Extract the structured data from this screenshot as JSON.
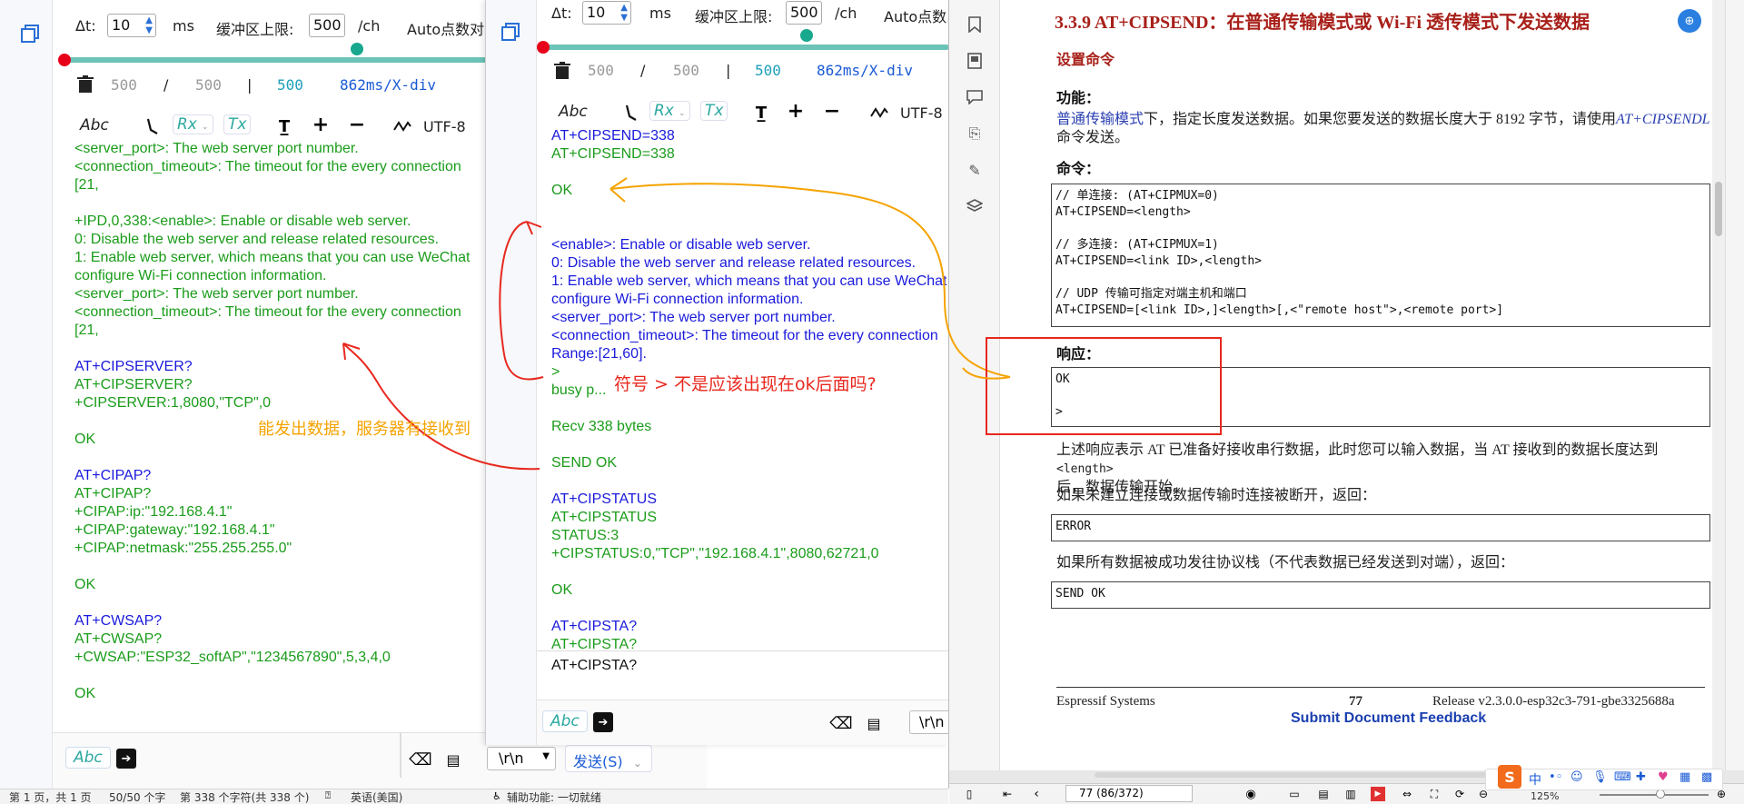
{
  "left_panel": {
    "delta_label": "Δt:",
    "delta_value": "10",
    "ms": "ms",
    "buffer_label": "缓冲区上限:",
    "buffer_value": "500",
    "per_ch": "/ch",
    "auto_label": "Auto点数对:",
    "count_a": "500",
    "slash": "/",
    "count_b": "500",
    "pipe": "|",
    "count_c": "500",
    "xdiv": "862ms/X-div",
    "fmt_abc": "Abc",
    "fmt_rx": "Rx",
    "fmt_tx": "Tx",
    "encoding": "UTF-8",
    "log_lines": [
      {
        "t": "<server_port>: The web server port number.",
        "c": "g"
      },
      {
        "t": "<connection_timeout>: The timeout for the every connection",
        "c": "g"
      },
      {
        "t": "[21,",
        "c": "g"
      },
      {
        "t": "",
        "c": "g"
      },
      {
        "t": "+IPD,0,338:<enable>: Enable or disable web server.",
        "c": "g"
      },
      {
        "t": "0: Disable the web server and release related resources.",
        "c": "g"
      },
      {
        "t": "1: Enable web server, which means that you can use WeChat",
        "c": "g"
      },
      {
        "t": "configure Wi-Fi connection information.",
        "c": "g"
      },
      {
        "t": "<server_port>: The web server port number.",
        "c": "g"
      },
      {
        "t": "<connection_timeout>: The timeout for the every connection",
        "c": "g"
      },
      {
        "t": "[21,",
        "c": "g"
      },
      {
        "t": "",
        "c": "g"
      },
      {
        "t": "AT+CIPSERVER?",
        "c": "b"
      },
      {
        "t": "AT+CIPSERVER?",
        "c": "g"
      },
      {
        "t": "+CIPSERVER:1,8080,\"TCP\",0",
        "c": "g"
      },
      {
        "t": "",
        "c": "g"
      },
      {
        "t": "OK",
        "c": "g"
      },
      {
        "t": "",
        "c": "g"
      },
      {
        "t": "AT+CIPAP?",
        "c": "b"
      },
      {
        "t": "AT+CIPAP?",
        "c": "g"
      },
      {
        "t": "+CIPAP:ip:\"192.168.4.1\"",
        "c": "g"
      },
      {
        "t": "+CIPAP:gateway:\"192.168.4.1\"",
        "c": "g"
      },
      {
        "t": "+CIPAP:netmask:\"255.255.255.0\"",
        "c": "g"
      },
      {
        "t": "",
        "c": "g"
      },
      {
        "t": "OK",
        "c": "g"
      },
      {
        "t": "",
        "c": "g"
      },
      {
        "t": "AT+CWSAP?",
        "c": "b"
      },
      {
        "t": "AT+CWSAP?",
        "c": "g"
      },
      {
        "t": "+CWSAP:\"ESP32_softAP\",\"1234567890\",5,3,4,0",
        "c": "g"
      },
      {
        "t": "",
        "c": "g"
      },
      {
        "t": "OK",
        "c": "g"
      }
    ],
    "bottom_abc": "Abc",
    "line_end": "\\r\\n",
    "send_button": "发送(S)"
  },
  "middle_panel": {
    "delta_label": "Δt:",
    "delta_value": "10",
    "ms": "ms",
    "buffer_label": "缓冲区上限:",
    "buffer_value": "500",
    "per_ch": "/ch",
    "auto_label": "Auto点数",
    "count_a": "500",
    "slash": "/",
    "count_b": "500",
    "pipe": "|",
    "count_c": "500",
    "xdiv": "862ms/X-div",
    "fmt_abc": "Abc",
    "fmt_rx": "Rx",
    "fmt_tx": "Tx",
    "encoding": "UTF-8",
    "log_lines": [
      {
        "t": "AT+CIPSEND=338",
        "c": "b"
      },
      {
        "t": "AT+CIPSEND=338",
        "c": "g"
      },
      {
        "t": "",
        "c": "g"
      },
      {
        "t": "OK",
        "c": "g"
      },
      {
        "t": "",
        "c": "g"
      },
      {
        "t": "",
        "c": "g"
      },
      {
        "t": "<enable>: Enable or disable web server.",
        "c": "b"
      },
      {
        "t": "0: Disable the web server and release related resources.",
        "c": "b"
      },
      {
        "t": "1: Enable web server, which means that you can use WeChat",
        "c": "b"
      },
      {
        "t": "configure Wi-Fi connection information.",
        "c": "b"
      },
      {
        "t": "<server_port>: The web server port number.",
        "c": "b"
      },
      {
        "t": "<connection_timeout>: The timeout for the every connection",
        "c": "b"
      },
      {
        "t": "Range:[21,60].",
        "c": "b"
      },
      {
        "t": ">",
        "c": "g"
      },
      {
        "t": "busy p...",
        "c": "g"
      },
      {
        "t": "",
        "c": "g"
      },
      {
        "t": "Recv 338 bytes",
        "c": "g"
      },
      {
        "t": "",
        "c": "g"
      },
      {
        "t": "SEND OK",
        "c": "g"
      },
      {
        "t": "",
        "c": "g"
      },
      {
        "t": "AT+CIPSTATUS",
        "c": "b"
      },
      {
        "t": "AT+CIPSTATUS",
        "c": "g"
      },
      {
        "t": "STATUS:3",
        "c": "g"
      },
      {
        "t": "+CIPSTATUS:0,\"TCP\",\"192.168.4.1\",8080,62721,0",
        "c": "g"
      },
      {
        "t": "",
        "c": "g"
      },
      {
        "t": "OK",
        "c": "g"
      },
      {
        "t": "",
        "c": "g"
      },
      {
        "t": "AT+CIPSTA?",
        "c": "b"
      },
      {
        "t": "AT+CIPSTA?",
        "c": "g"
      }
    ],
    "input_text": "AT+CIPSTA?",
    "bottom_abc": "Abc",
    "line_end": "\\r\\n"
  },
  "annotations": {
    "left_note": "能发出数据，服务器有接收到",
    "mid_note": "符号 > 不是应该出现在ok后面吗?",
    "colors": {
      "orange": "#f5a300",
      "red": "#e8281e"
    }
  },
  "pdf": {
    "section_title": "3.3.9   AT+CIPSEND：在普通传输模式或 Wi-Fi 透传模式下发送数据",
    "set_cmd": "设置命令",
    "func_label": "功能：",
    "func_link": "普通传输模式",
    "func_text1": "下，指定长度发送数据。如果您要发送的数据长度大于 8192 字节，请使用",
    "func_link2": "AT+CIPSENDL",
    "func_text2": "命令发送。",
    "cmd_label": "命令：",
    "code_block": "// 单连接: (AT+CIPMUX=0)\nAT+CIPSEND=<length>\n\n// 多连接: (AT+CIPMUX=1)\nAT+CIPSEND=<link ID>,<length>\n\n// UDP 传输可指定对端主机和端口\nAT+CIPSEND=[<link ID>,]<length>[,<\"remote host\">,<remote port>]",
    "resp_label": "响应：",
    "resp_block": "OK\n\n>",
    "desc1a": "上述响应表示 AT 已准备好接收串行数据，此时您可以输入数据，当 AT 接收到的数据长度达到 ",
    "desc1_code": "<length>",
    "desc1b": "后，数据传输开始。",
    "desc2": "如果未建立连接或数据传输时连接被断开，返回：",
    "error_block": "ERROR",
    "desc3": "如果所有数据被成功发往协议栈（不代表数据已经发送到对端），返回：",
    "sendok_block": "SEND OK",
    "footer_left": "Espressif Systems",
    "footer_page": "77",
    "footer_right": "Release v2.3.0.0-esp32c3-791-gbe3325688a",
    "feedback": "Submit Document Feedback",
    "page_box": "77 (86/372)",
    "zoom": "125%"
  },
  "status_bar": {
    "page": "第 1 页，共 1 页",
    "words": "50/50 个字",
    "chars": "第 338 个字符(共 338 个)",
    "lang": "英语(美国)",
    "access": "辅助功能: 一切就绪"
  }
}
